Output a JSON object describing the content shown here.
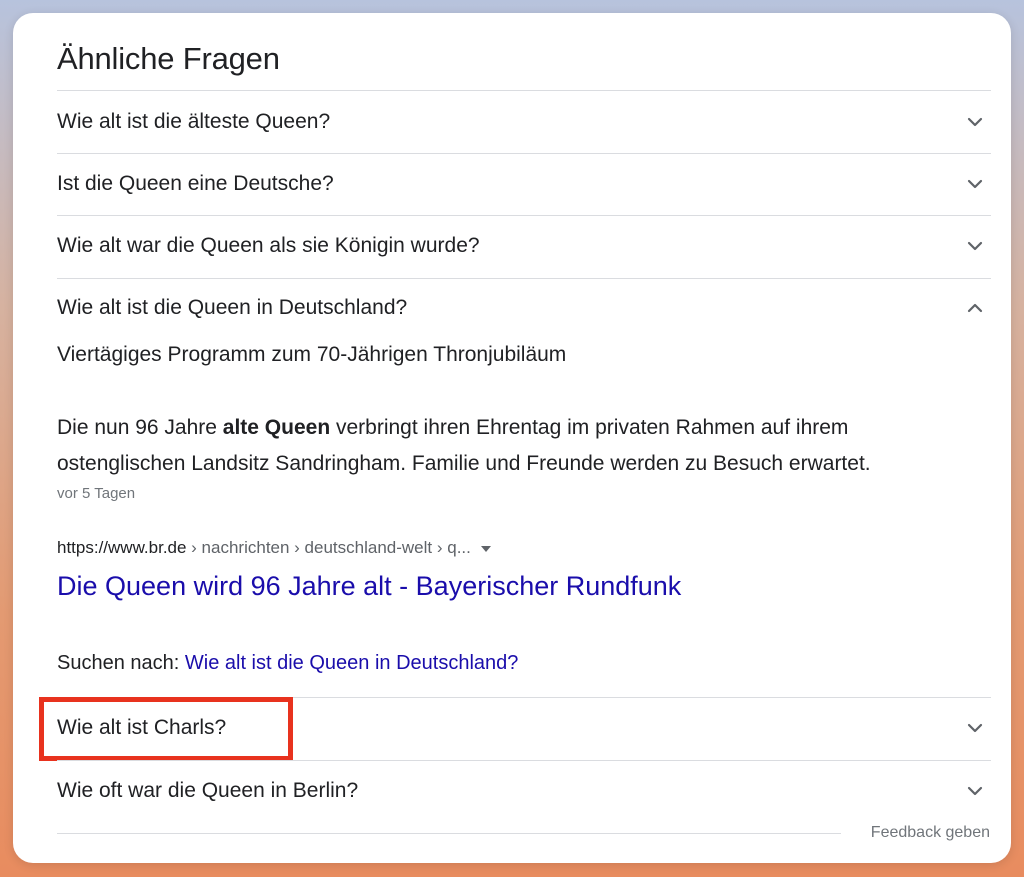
{
  "title": "Ähnliche Fragen",
  "questions": [
    {
      "label": "Wie alt ist die älteste Queen?",
      "expanded": false
    },
    {
      "label": "Ist die Queen eine Deutsche?",
      "expanded": false
    },
    {
      "label": "Wie alt war die Queen als sie Königin wurde?",
      "expanded": false
    },
    {
      "label": "Wie alt ist die Queen in Deutschland?",
      "expanded": true
    },
    {
      "label": "Wie alt ist Charls?",
      "expanded": false,
      "highlighted": true
    },
    {
      "label": "Wie oft war die Queen in Berlin?",
      "expanded": false
    }
  ],
  "answer": {
    "heading": "Viertägiges Programm zum 70-Jährigen Thronjubiläum",
    "body_before": "Die nun 96 Jahre ",
    "body_bold": "alte Queen",
    "body_after": " verbringt ihren Ehrentag im privaten Rahmen auf ihrem ostenglischen Landsitz Sandringham. Familie und Freunde werden zu Besuch erwartet.",
    "date": "vor 5 Tagen",
    "source_domain": "https://www.br.de",
    "source_path": " › nachrichten › deutschland-welt › q...",
    "link_title": "Die Queen wird 96 Jahre alt - Bayerischer Rundfunk",
    "search_prefix": "Suchen nach: ",
    "search_link": "Wie alt ist die Queen in Deutschland?"
  },
  "feedback_label": "Feedback geben",
  "colors": {
    "link": "#1a0dab",
    "text": "#202124",
    "muted": "#70757a",
    "highlight": "#e8321e"
  }
}
